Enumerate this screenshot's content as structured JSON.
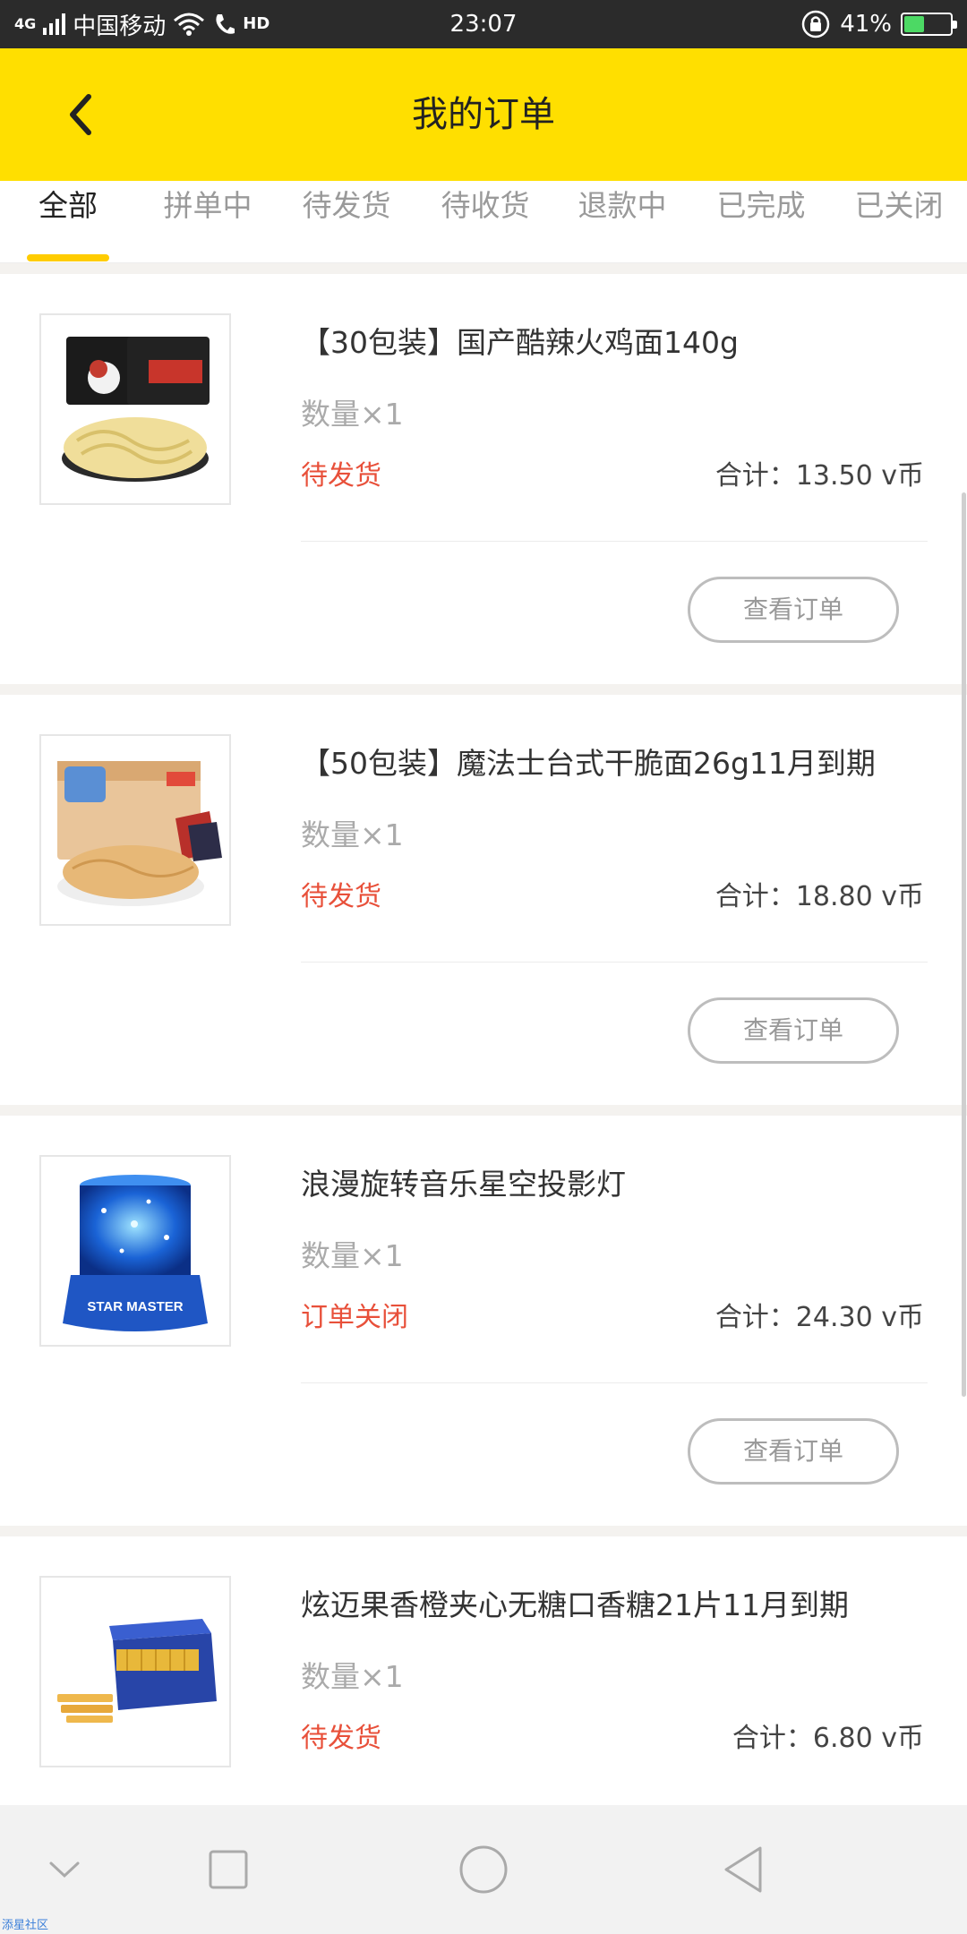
{
  "status_bar": {
    "network": "4G",
    "carrier": "中国移动",
    "hd": "HD",
    "time": "23:07",
    "battery": "41%"
  },
  "header": {
    "title": "我的订单"
  },
  "tabs": [
    {
      "label": "全部",
      "active": true
    },
    {
      "label": "拼单中",
      "active": false
    },
    {
      "label": "待发货",
      "active": false
    },
    {
      "label": "待收货",
      "active": false
    },
    {
      "label": "退款中",
      "active": false
    },
    {
      "label": "已完成",
      "active": false
    },
    {
      "label": "已关闭",
      "active": false
    }
  ],
  "orders": [
    {
      "title": "【30包装】国产酷辣火鸡面140g",
      "quantity": "数量×1",
      "status": "待发货",
      "total": "合计：13.50 v币",
      "button": "查看订单"
    },
    {
      "title": "【50包装】魔法士台式干脆面26g11月到期",
      "quantity": "数量×1",
      "status": "待发货",
      "total": "合计：18.80 v币",
      "button": "查看订单"
    },
    {
      "title": "浪漫旋转音乐星空投影灯",
      "quantity": "数量×1",
      "status": "订单关闭",
      "total": "合计：24.30 v币",
      "button": "查看订单",
      "image_text": "STAR MASTER"
    },
    {
      "title": "炫迈果香橙夹心无糖口香糖21片11月到期",
      "quantity": "数量×1",
      "status": "待发货",
      "total": "合计：6.80 v币"
    }
  ],
  "watermark": "添星社区",
  "colors": {
    "brand_yellow": "#ffdf00",
    "status_red": "#e8503a",
    "tab_underline": "#ffcc00"
  }
}
